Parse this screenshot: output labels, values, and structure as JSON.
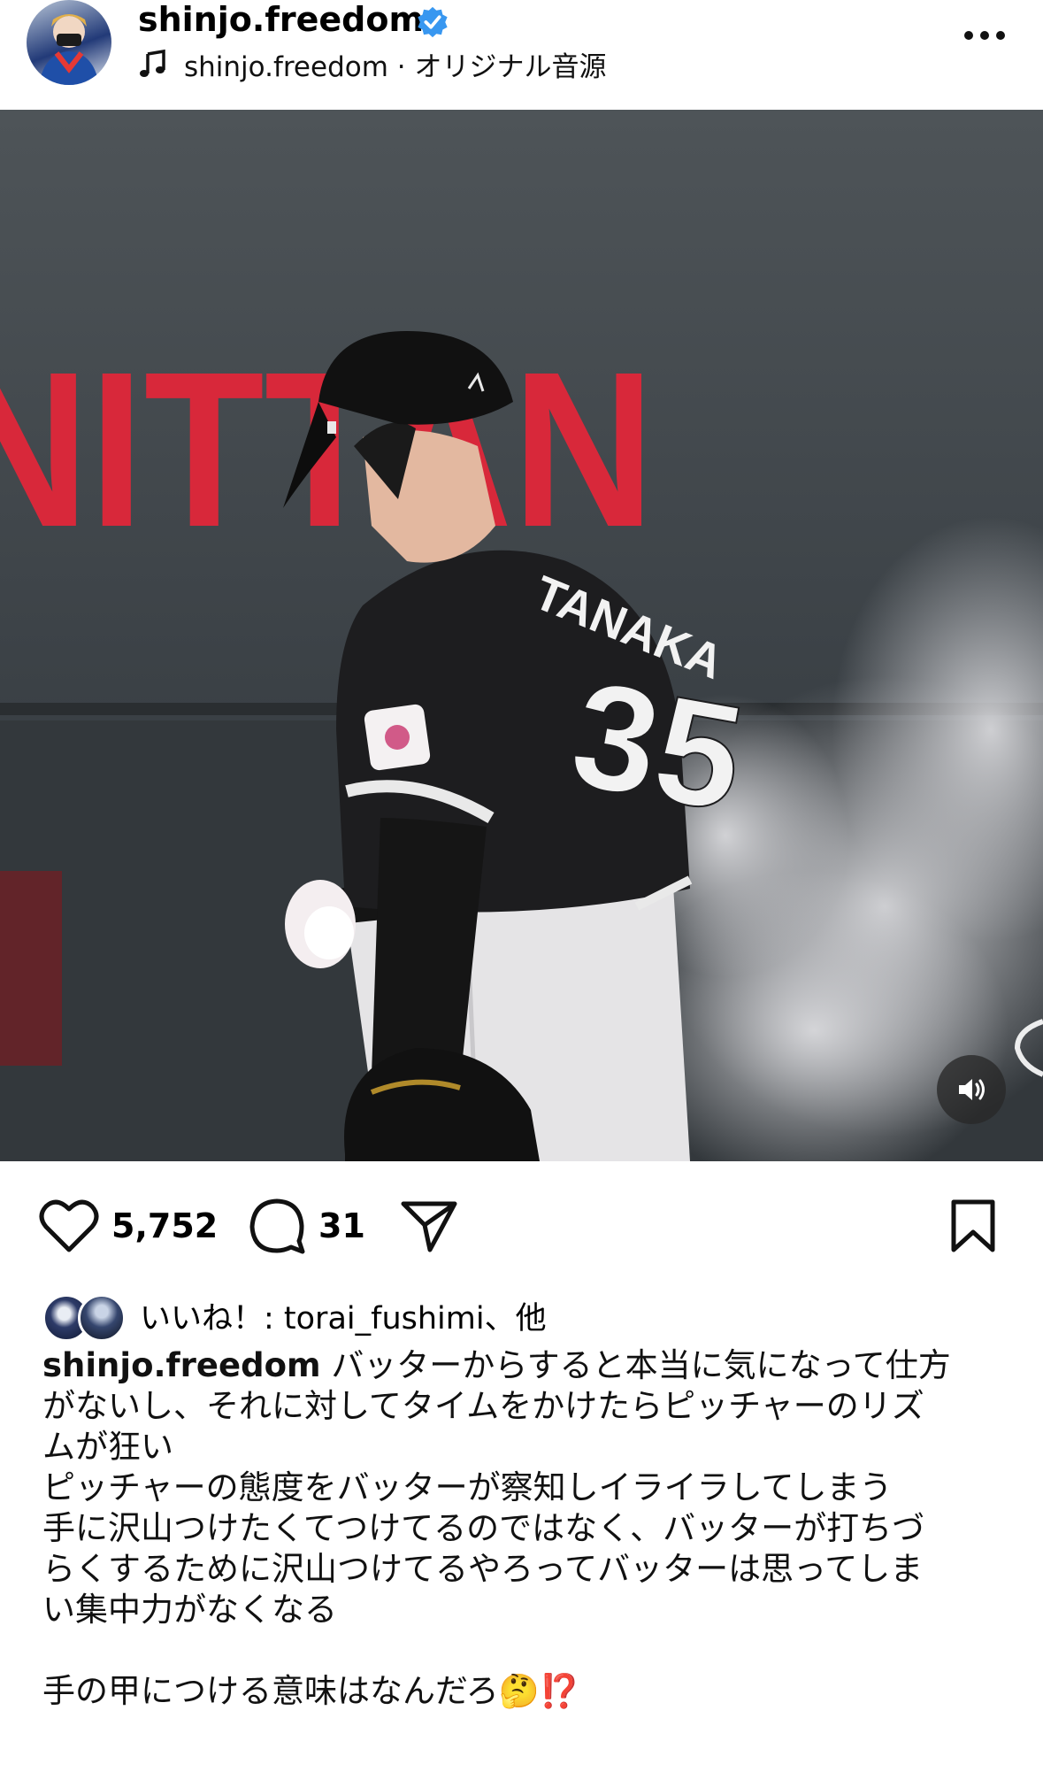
{
  "header": {
    "username": "shinjo.freedom",
    "audio_label": "shinjo.freedom · オリジナル音源"
  },
  "media": {
    "sign_text": "NITTAN",
    "jersey_name": "TANAKA",
    "jersey_number": "35"
  },
  "actions": {
    "like_count": "5,752",
    "comment_count": "31"
  },
  "likes": {
    "text": "いいね！: torai_fushimi、他"
  },
  "caption": {
    "username": "shinjo.freedom",
    "text_1": "バッターからすると本当に気になって仕方",
    "text_2": "がないし、それに対してタイムをかけたらピッチャーのリズ",
    "text_3": "ムが狂い",
    "text_4": "ピッチャーの態度をバッターが察知しイライラしてしまう",
    "text_5": "手に沢山つけたくてつけてるのではなく、バッターが打ちづ",
    "text_6": "らくするために沢山つけてるやろってバッターは思ってしま",
    "text_7": "い集中力がなくなる",
    "text_8": "手の甲につける意味はなんだろ🤔⁉️"
  }
}
